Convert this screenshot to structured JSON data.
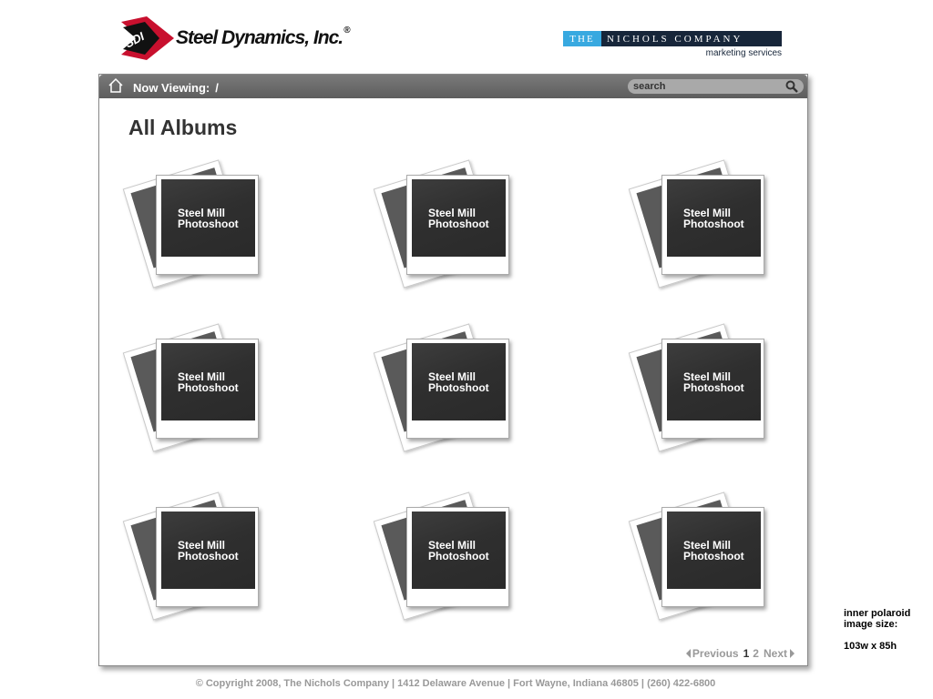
{
  "logos": {
    "sdi": {
      "mark": "SDI",
      "name": "Steel Dynamics, Inc.",
      "registered": "®"
    },
    "nichols": {
      "the": "THE",
      "name": "NICHOLS COMPANY",
      "tagline": "marketing services"
    }
  },
  "topbar": {
    "now_viewing_label": "Now Viewing:",
    "path": "/",
    "search_placeholder": "search"
  },
  "page_title": "All Albums",
  "albums": [
    {
      "title": "Steel Mill Photoshoot"
    },
    {
      "title": "Steel Mill Photoshoot"
    },
    {
      "title": "Steel Mill Photoshoot"
    },
    {
      "title": "Steel Mill Photoshoot"
    },
    {
      "title": "Steel Mill Photoshoot"
    },
    {
      "title": "Steel Mill Photoshoot"
    },
    {
      "title": "Steel Mill Photoshoot"
    },
    {
      "title": "Steel Mill Photoshoot"
    },
    {
      "title": "Steel Mill Photoshoot"
    }
  ],
  "pagination": {
    "previous_label": "Previous",
    "current_page": "1",
    "other_page": "2",
    "next_label": "Next"
  },
  "footer": "© Copyright 2008, The Nichols Company | 1412 Delaware Avenue | Fort Wayne, Indiana 46805 | (260) 422-6800",
  "side_note": {
    "label_line1": "inner polaroid",
    "label_line2": "image size:",
    "size": "103w x 85h"
  },
  "colors": {
    "topbar": "#6b6b6b",
    "photo": "#333333",
    "nichols_blue": "#38a9e0",
    "nichols_navy": "#17263a",
    "sdi_red": "#c8102e"
  }
}
